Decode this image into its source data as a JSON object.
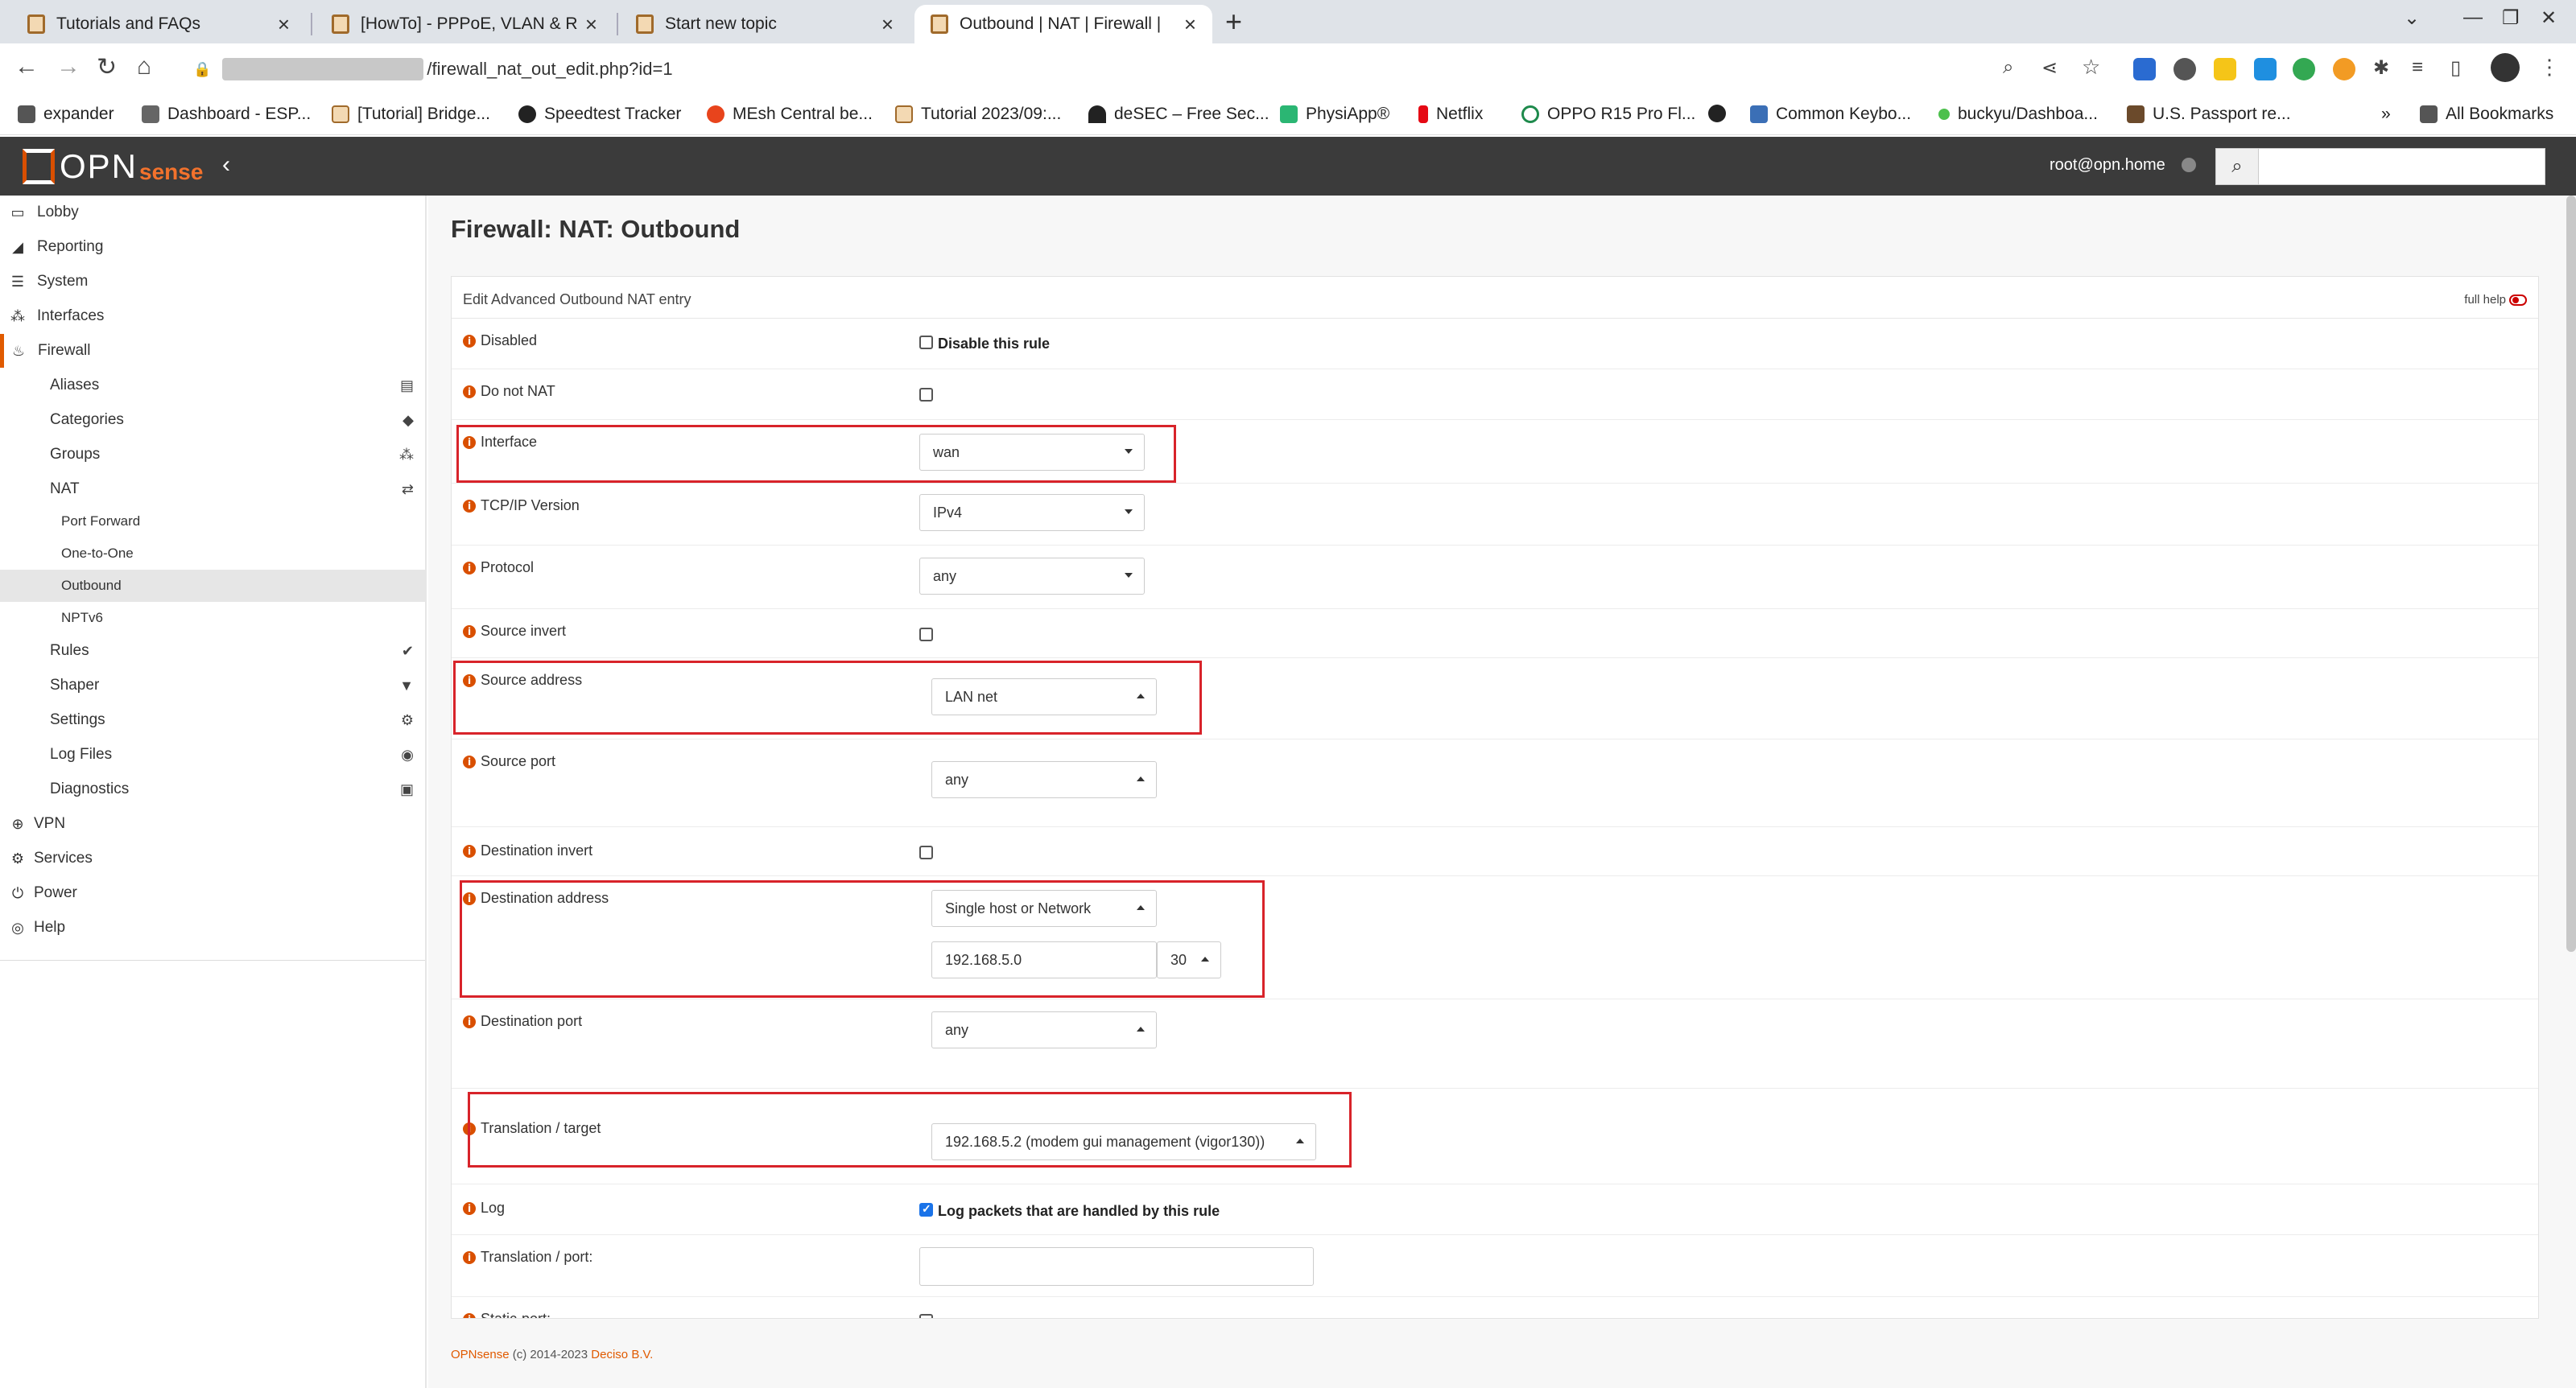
{
  "browser": {
    "tabs": [
      {
        "title": "Tutorials and FAQs",
        "active": false
      },
      {
        "title": "[HowTo] - PPPoE, VLAN & RF",
        "active": false
      },
      {
        "title": "Start new topic",
        "active": false
      },
      {
        "title": "Outbound | NAT | Firewall |",
        "active": true
      }
    ],
    "url": "/firewall_nat_out_edit.php?id=1",
    "bookmarks": [
      "expander",
      "Dashboard - ESP...",
      "[Tutorial] Bridge...",
      "Speedtest Tracker",
      "MEsh Central be...",
      "Tutorial 2023/09:...",
      "deSEC – Free Sec...",
      "PhysiApp®",
      "Netflix",
      "OPPO R15 Pro Fl...",
      "",
      "Common Keybo...",
      "buckyu/Dashboa...",
      "U.S. Passport re..."
    ],
    "bookmarks_more": "»",
    "all_bookmarks": "All Bookmarks"
  },
  "header": {
    "logo_text": "OPN",
    "logo_accent": "sense",
    "user": "root@opn.home",
    "accent_color": "#d94f00"
  },
  "sidebar": {
    "items": [
      {
        "label": "Lobby",
        "icon": "laptop-icon"
      },
      {
        "label": "Reporting",
        "icon": "area-chart-icon"
      },
      {
        "label": "System",
        "icon": "server-icon"
      },
      {
        "label": "Interfaces",
        "icon": "sitemap-icon"
      },
      {
        "label": "Firewall",
        "icon": "fire-icon"
      },
      {
        "label": "Aliases",
        "icon": "list-alt-icon"
      },
      {
        "label": "Categories",
        "icon": "tags-icon"
      },
      {
        "label": "Groups",
        "icon": "sitemap-icon"
      },
      {
        "label": "NAT",
        "icon": "exchange-icon"
      },
      {
        "label": "Port Forward"
      },
      {
        "label": "One-to-One"
      },
      {
        "label": "Outbound"
      },
      {
        "label": "NPTv6"
      },
      {
        "label": "Rules",
        "icon": "check-icon"
      },
      {
        "label": "Shaper",
        "icon": "filter-icon"
      },
      {
        "label": "Settings",
        "icon": "cogs-icon"
      },
      {
        "label": "Log Files",
        "icon": "eye-icon"
      },
      {
        "label": "Diagnostics",
        "icon": "medkit-icon"
      },
      {
        "label": "VPN",
        "icon": "globe-icon"
      },
      {
        "label": "Services",
        "icon": "cog-icon"
      },
      {
        "label": "Power",
        "icon": "plug-icon"
      },
      {
        "label": "Help",
        "icon": "life-ring-icon"
      }
    ]
  },
  "main": {
    "page_title": "Firewall: NAT: Outbound",
    "panel_title": "Edit Advanced Outbound NAT entry",
    "full_help": "full help",
    "disabled": {
      "label": "Disabled",
      "checkbox_text": "Disable this rule",
      "checked": false
    },
    "do_not_nat": {
      "label": "Do not NAT",
      "checked": false
    },
    "interface": {
      "label": "Interface",
      "value": "wan"
    },
    "tcpip_version": {
      "label": "TCP/IP Version",
      "value": "IPv4"
    },
    "protocol": {
      "label": "Protocol",
      "value": "any"
    },
    "source_invert": {
      "label": "Source invert",
      "checked": false
    },
    "source_address": {
      "label": "Source address",
      "value": "LAN net"
    },
    "source_port": {
      "label": "Source port",
      "value": "any"
    },
    "destination_invert": {
      "label": "Destination invert",
      "checked": false
    },
    "destination_address": {
      "label": "Destination address",
      "type": "Single host or Network",
      "network": "192.168.5.0",
      "mask": "30"
    },
    "destination_port": {
      "label": "Destination port",
      "value": "any"
    },
    "translation_target": {
      "label": "Translation / target",
      "value": "192.168.5.2 (modem gui management (vigor130))"
    },
    "log": {
      "label": "Log",
      "checkbox_text": "Log packets that are handled by this rule",
      "checked": true
    },
    "translation_port": {
      "label": "Translation / port:",
      "value": ""
    },
    "static_port": {
      "label": "Static-port:",
      "checked": false
    }
  },
  "footer": {
    "brand": "OPNsense",
    "copyright": "(c) 2014-2023",
    "company": "Deciso B.V."
  }
}
